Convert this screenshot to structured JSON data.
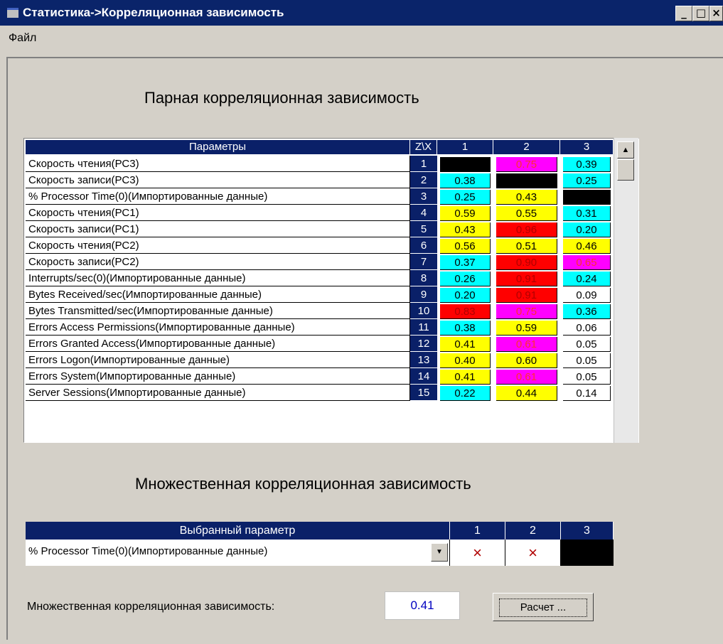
{
  "window": {
    "title": "Статистика->Корреляционная зависимость",
    "min": "_",
    "max": "□",
    "close": "×"
  },
  "menu": {
    "file": "Файл"
  },
  "pair": {
    "title": "Парная корреляционная зависимость",
    "headers": {
      "param": "Параметры",
      "zx": "Z\\X",
      "c1": "1",
      "c2": "2",
      "c3": "3"
    },
    "rows": [
      {
        "name": "Скорость чтения(РС3)",
        "num": "1",
        "v": [
          "",
          "0.75",
          "0.39"
        ],
        "c": [
          "#000000",
          "#ff00ff",
          "#00ffff"
        ]
      },
      {
        "name": "Скорость записи(РС3)",
        "num": "2",
        "v": [
          "0.38",
          "",
          "0.25"
        ],
        "c": [
          "#00ffff",
          "#000000",
          "#00ffff"
        ]
      },
      {
        "name": "% Processor Time(0)(Импортированные данные)",
        "num": "3",
        "v": [
          "0.25",
          "0.43",
          ""
        ],
        "c": [
          "#00ffff",
          "#ffff00",
          "#000000"
        ]
      },
      {
        "name": "Скорость чтения(РС1)",
        "num": "4",
        "v": [
          "0.59",
          "0.55",
          "0.31"
        ],
        "c": [
          "#ffff00",
          "#ffff00",
          "#00ffff"
        ]
      },
      {
        "name": "Скорость записи(РС1)",
        "num": "5",
        "v": [
          "0.43",
          "0.96",
          "0.20"
        ],
        "c": [
          "#ffff00",
          "#ff0000",
          "#00ffff"
        ]
      },
      {
        "name": "Скорость чтения(РС2)",
        "num": "6",
        "v": [
          "0.56",
          "0.51",
          "0.46"
        ],
        "c": [
          "#ffff00",
          "#ffff00",
          "#ffff00"
        ]
      },
      {
        "name": "Скорость записи(РС2)",
        "num": "7",
        "v": [
          "0.37",
          "0.90",
          "0.65"
        ],
        "c": [
          "#00ffff",
          "#ff0000",
          "#ff00ff"
        ]
      },
      {
        "name": "Interrupts/sec(0)(Импортированные данные)",
        "num": "8",
        "v": [
          "0.26",
          "0.91",
          "0.24"
        ],
        "c": [
          "#00ffff",
          "#ff0000",
          "#00ffff"
        ]
      },
      {
        "name": "Bytes Received/sec(Импортированные данные)",
        "num": "9",
        "v": [
          "0.20",
          "0.91",
          "0.09"
        ],
        "c": [
          "#00ffff",
          "#ff0000",
          "#ffffff"
        ]
      },
      {
        "name": "Bytes Transmitted/sec(Импортированные данные)",
        "num": "10",
        "v": [
          "0.83",
          "0.75",
          "0.36"
        ],
        "c": [
          "#ff0000",
          "#ff00ff",
          "#00ffff"
        ]
      },
      {
        "name": "Errors Access Permissions(Импортированные данные)",
        "num": "11",
        "v": [
          "0.38",
          "0.59",
          "0.06"
        ],
        "c": [
          "#00ffff",
          "#ffff00",
          "#ffffff"
        ]
      },
      {
        "name": "Errors Granted Access(Импортированные данные)",
        "num": "12",
        "v": [
          "0.41",
          "0.61",
          "0.05"
        ],
        "c": [
          "#ffff00",
          "#ff00ff",
          "#ffffff"
        ]
      },
      {
        "name": "Errors Logon(Импортированные данные)",
        "num": "13",
        "v": [
          "0.40",
          "0.60",
          "0.05"
        ],
        "c": [
          "#ffff00",
          "#ffff00",
          "#ffffff"
        ]
      },
      {
        "name": "Errors System(Импортированные данные)",
        "num": "14",
        "v": [
          "0.41",
          "0.61",
          "0.05"
        ],
        "c": [
          "#ffff00",
          "#ff00ff",
          "#ffffff"
        ]
      },
      {
        "name": "Server Sessions(Импортированные данные)",
        "num": "15",
        "v": [
          "0.22",
          "0.44",
          "0.14"
        ],
        "c": [
          "#00ffff",
          "#ffff00",
          "#ffffff"
        ]
      }
    ]
  },
  "multi": {
    "title": "Множественная  корреляционная зависимость",
    "headers": {
      "param": "Выбранный параметр",
      "c1": "1",
      "c2": "2",
      "c3": "3"
    },
    "selected": "% Processor Time(0)(Импортированные данные)",
    "marks": [
      "×",
      "×"
    ],
    "result_label": "Множественная корреляционная зависимость:",
    "result_value": "0.41",
    "calc_label": "Расчет ..."
  }
}
